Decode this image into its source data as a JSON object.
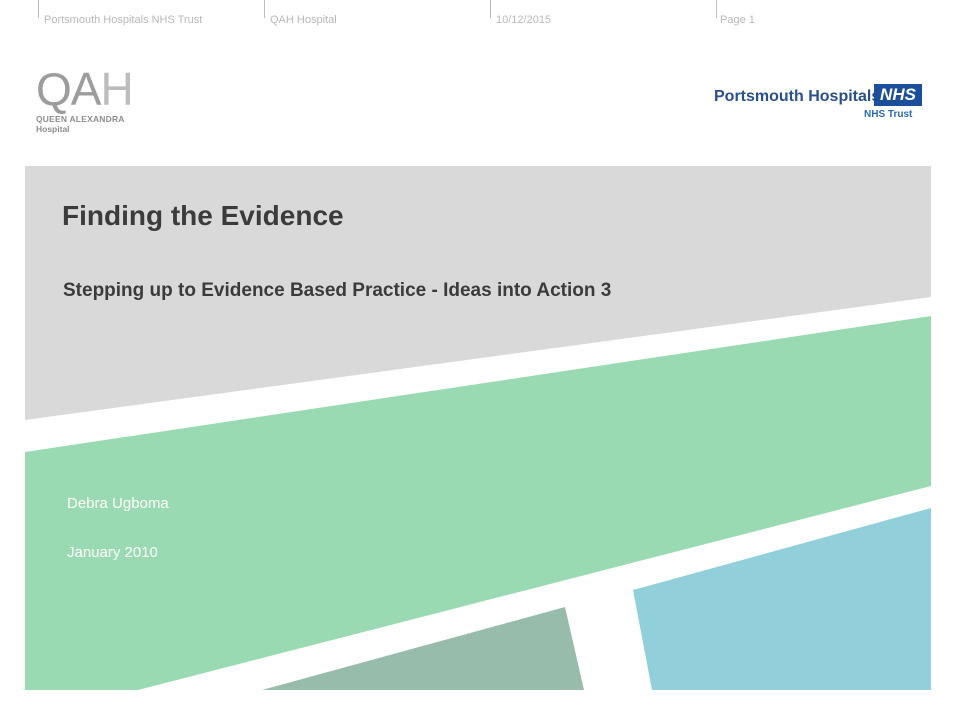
{
  "header": {
    "organisation": "Portsmouth Hospitals NHS Trust",
    "hospital": "QAH Hospital",
    "date": "10/12/2015",
    "page": "Page 1"
  },
  "logos": {
    "qah": {
      "mark_main": "QA",
      "mark_end": "H",
      "line1": "QUEEN ALEXANDRA",
      "line2": "Hospital"
    },
    "nhs": {
      "name": "Portsmouth Hospitals",
      "badge": "NHS",
      "trust": "NHS Trust"
    }
  },
  "slide": {
    "title": "Finding the Evidence",
    "subtitle": "Stepping up to Evidence Based Practice - Ideas into Action 3",
    "author": "Debra  Ugboma",
    "date": "January  2010"
  },
  "colors": {
    "grey_band": "#d9d9d9",
    "green_band": "#9adab3",
    "dark_green": "#98bcac",
    "blue": "#91d0da",
    "title_text": "#3b3b3b"
  }
}
